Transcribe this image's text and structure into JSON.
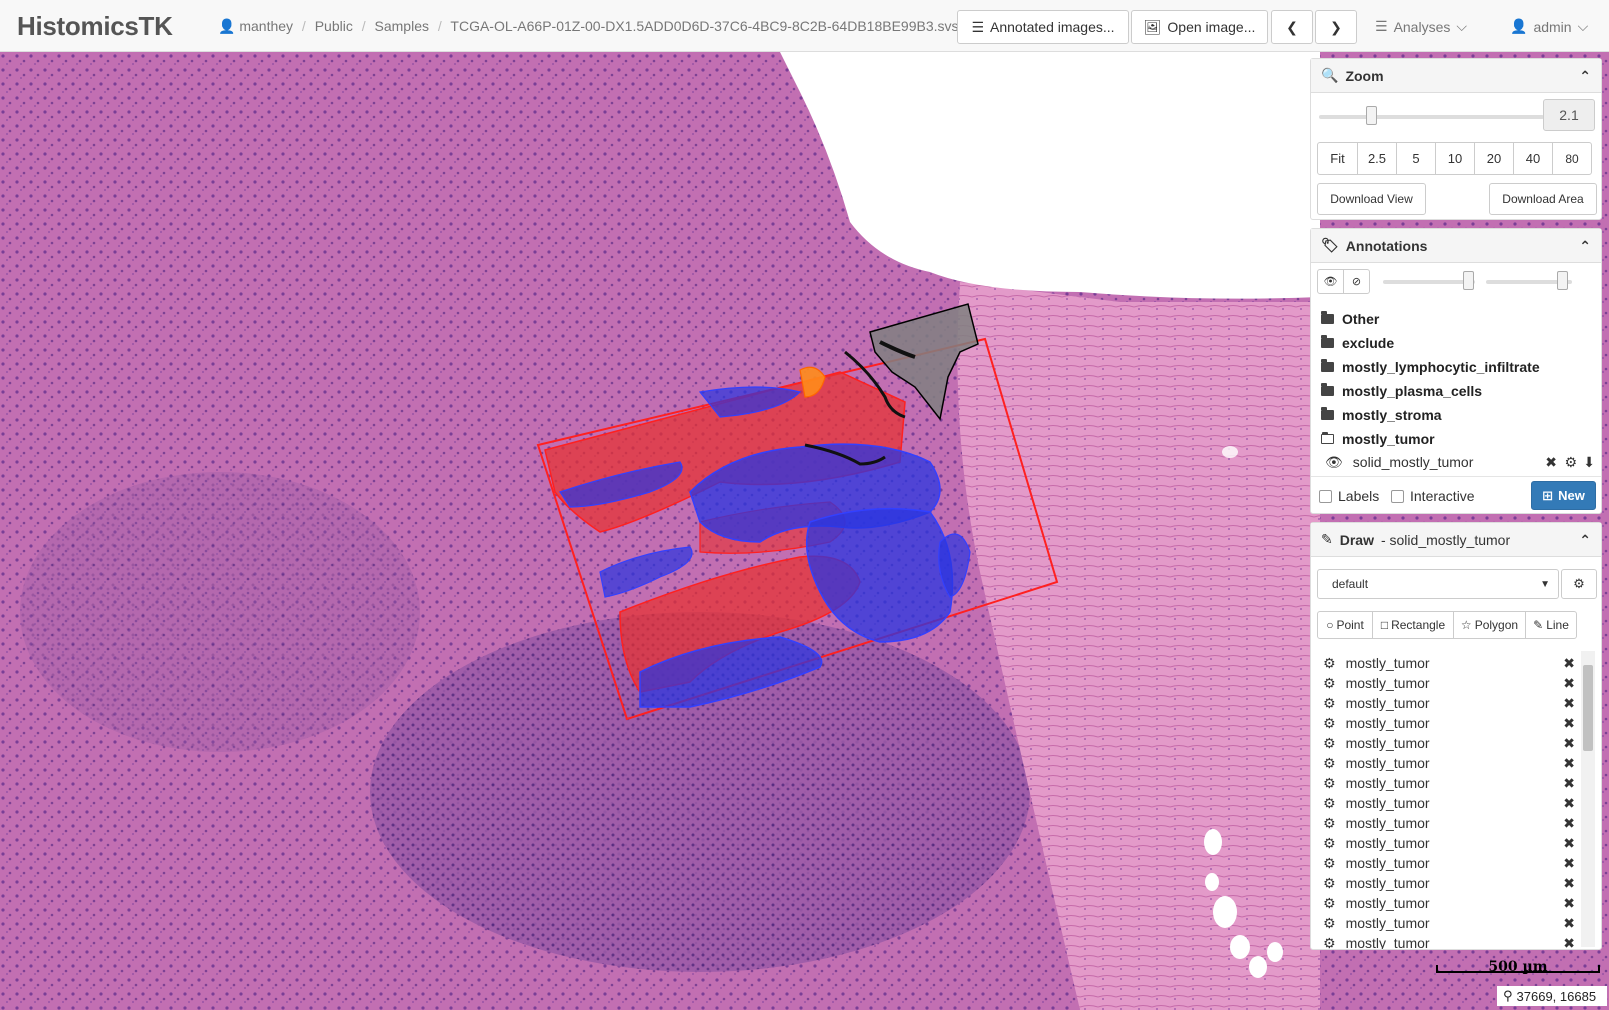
{
  "app": {
    "brand": "HistomicsTK"
  },
  "breadcrumb": {
    "user": "manthey",
    "folder1": "Public",
    "folder2": "Samples",
    "file": "TCGA-OL-A66P-01Z-00-DX1.5ADD0D6D-37C6-4BC9-8C2B-64DB18BE99B3.svs"
  },
  "toolbar": {
    "annotated_images": "Annotated images...",
    "open_image": "Open image...",
    "analyses": "Analyses",
    "user_menu": "admin"
  },
  "zoom": {
    "title": "Zoom",
    "value": "2.1",
    "level": 0.23,
    "presets": [
      "Fit",
      "2.5",
      "5",
      "10",
      "20",
      "40",
      "80"
    ],
    "download_view": "Download View",
    "download_area": "Download Area"
  },
  "annotations": {
    "title": "Annotations",
    "folders": [
      "Other",
      "exclude",
      "mostly_lymphocytic_infiltrate",
      "mostly_plasma_cells",
      "mostly_stroma",
      "mostly_tumor"
    ],
    "open_item": "solid_mostly_tumor",
    "labels": "Labels",
    "interactive": "Interactive",
    "new": "New"
  },
  "draw": {
    "title_prefix": "Draw",
    "title_target": "- solid_mostly_tumor",
    "style": "default",
    "tools": [
      "Point",
      "Rectangle",
      "Polygon",
      "Line"
    ],
    "elements": [
      "mostly_tumor",
      "mostly_tumor",
      "mostly_tumor",
      "mostly_tumor",
      "mostly_tumor",
      "mostly_tumor",
      "mostly_tumor",
      "mostly_tumor",
      "mostly_tumor",
      "mostly_tumor",
      "mostly_tumor",
      "mostly_tumor",
      "mostly_tumor",
      "mostly_tumor",
      "mostly_tumor"
    ]
  },
  "scale": {
    "label": "500 µm"
  },
  "coords": {
    "value": "37669, 16685"
  },
  "colors": {
    "tissue": "#c873b6",
    "annotation_red": "#e8312f",
    "annotation_blue": "#2a35e0",
    "annotation_gray": "#808080",
    "new_button": "#337ab7"
  }
}
